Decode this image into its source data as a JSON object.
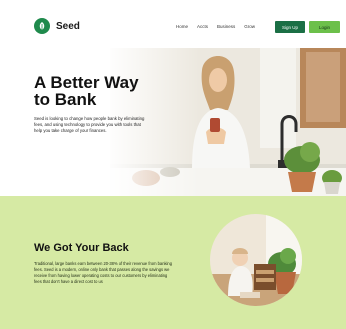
{
  "header": {
    "logo_text": "Seed",
    "nav": [
      "Home",
      "Accts",
      "Business",
      "Grow"
    ],
    "signup_label": "Sign Up",
    "login_label": "Login"
  },
  "hero": {
    "title_line1": "A Better Way",
    "title_line2": "to Bank",
    "description": "Seed is looking to change how people bank by eliminating fees, and using technology to provide you with tools that help you take charge of your finances."
  },
  "section2": {
    "title": "We Got Your Back",
    "description": "Traditional, large banks earn between 20-38% of their revenue from banking fees. Seed is a modern, online only bank that passes along the savings we receive from having lower operating costs to our customers by eliminating fees that don't have a direct cost to us"
  },
  "colors": {
    "brand_green": "#1b6f45",
    "login_green": "#6cc04a",
    "section_bg": "#d6eaa4"
  }
}
